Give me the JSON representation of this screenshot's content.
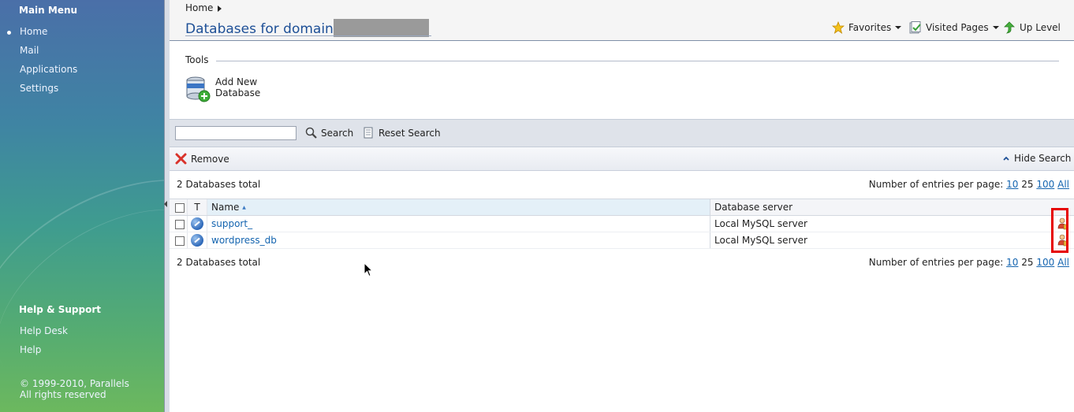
{
  "sidebar": {
    "main_menu_title": "Main Menu",
    "items": [
      {
        "label": "Home",
        "active": true
      },
      {
        "label": "Mail",
        "active": false
      },
      {
        "label": "Applications",
        "active": false
      },
      {
        "label": "Settings",
        "active": false
      }
    ],
    "help_title": "Help & Support",
    "help_items": [
      {
        "label": "Help Desk"
      },
      {
        "label": "Help"
      }
    ],
    "copyright_line1": "© 1999-2010, Parallels",
    "copyright_line2": "All rights reserved"
  },
  "header": {
    "breadcrumb_home": "Home",
    "title": "Databases for domain",
    "favorites_label": "Favorites",
    "visited_pages_label": "Visited Pages",
    "up_level_label": "Up Level"
  },
  "tools": {
    "section_label": "Tools",
    "add_new_line1": "Add New",
    "add_new_line2": "Database"
  },
  "search": {
    "value": "",
    "search_label": "Search",
    "reset_label": "Reset Search"
  },
  "actions": {
    "remove_label": "Remove",
    "hide_search_label": "Hide Search"
  },
  "summary": {
    "total_text": "2 Databases total",
    "per_page_label": "Number of entries per page:",
    "per_page_options": [
      "10",
      "25",
      "100",
      "All"
    ],
    "per_page_selected": "25"
  },
  "table": {
    "columns": {
      "type": "T",
      "name": "Name",
      "server": "Database server"
    },
    "sort_indicator": "▲",
    "rows": [
      {
        "name": "support_",
        "server": "Local MySQL server"
      },
      {
        "name": "wordpress_db",
        "server": "Local MySQL server"
      }
    ]
  },
  "colors": {
    "accent_title": "#1d4f96",
    "link": "#1565b0",
    "highlight_box": "#e60000"
  }
}
